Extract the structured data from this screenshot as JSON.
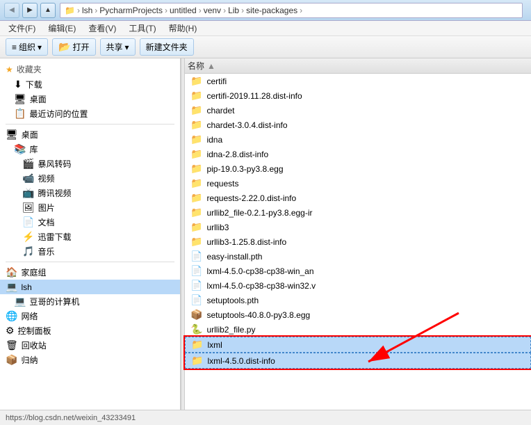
{
  "titleBar": {
    "backLabel": "◀",
    "forwardLabel": "▶",
    "upLabel": "▲",
    "dropLabel": "▼",
    "breadcrumb": [
      "lsh",
      "PycharmProjects",
      "untitled",
      "venv",
      "Lib",
      "site-packages"
    ]
  },
  "menuBar": {
    "items": [
      "文件(F)",
      "编辑(E)",
      "查看(V)",
      "工具(T)",
      "帮助(H)"
    ]
  },
  "toolbar": {
    "organizeLabel": "组织",
    "openLabel": "打开",
    "shareLabel": "共享",
    "newFolderLabel": "新建文件夹"
  },
  "sidebar": {
    "favorites": {
      "header": "收藏夹",
      "items": [
        "下载",
        "桌面",
        "最近访问的位置"
      ]
    },
    "desktop": {
      "header": "桌面",
      "library": {
        "header": "库",
        "items": [
          "暴风转码",
          "视频",
          "腾讯视频",
          "图片",
          "文档",
          "迅雷下载",
          "音乐"
        ]
      }
    },
    "homeGroup": "家庭组",
    "lsh": {
      "label": "lsh",
      "selected": true
    },
    "others": [
      "豆哥的计算机",
      "网络",
      "控制面板",
      "回收站",
      "归纳"
    ]
  },
  "fileList": {
    "columnHeader": "名称",
    "items": [
      {
        "name": "certifi",
        "type": "folder"
      },
      {
        "name": "certifi-2019.11.28.dist-info",
        "type": "folder"
      },
      {
        "name": "chardet",
        "type": "folder"
      },
      {
        "name": "chardet-3.0.4.dist-info",
        "type": "folder"
      },
      {
        "name": "idna",
        "type": "folder"
      },
      {
        "name": "idna-2.8.dist-info",
        "type": "folder"
      },
      {
        "name": "pip-19.0.3-py3.8.egg",
        "type": "folder"
      },
      {
        "name": "requests",
        "type": "folder"
      },
      {
        "name": "requests-2.22.0.dist-info",
        "type": "folder"
      },
      {
        "name": "urllib2_file-0.2.1-py3.8.egg-ir",
        "type": "folder"
      },
      {
        "name": "urllib3",
        "type": "folder"
      },
      {
        "name": "urllib3-1.25.8.dist-info",
        "type": "folder"
      },
      {
        "name": "easy-install.pth",
        "type": "pth"
      },
      {
        "name": "lxml-4.5.0-cp38-cp38-win_an",
        "type": "file"
      },
      {
        "name": "lxml-4.5.0-cp38-cp38-win32.v",
        "type": "file"
      },
      {
        "name": "setuptools.pth",
        "type": "pth"
      },
      {
        "name": "setuptools-40.8.0-py3.8.egg",
        "type": "egg"
      },
      {
        "name": "urllib2_file.py",
        "type": "py"
      },
      {
        "name": "lxml",
        "type": "folder",
        "highlighted": true
      },
      {
        "name": "lxml-4.5.0.dist-info",
        "type": "folder",
        "highlighted": true
      }
    ]
  },
  "statusBar": {
    "url": "https://blog.csdn.net/weixin_43233491"
  }
}
